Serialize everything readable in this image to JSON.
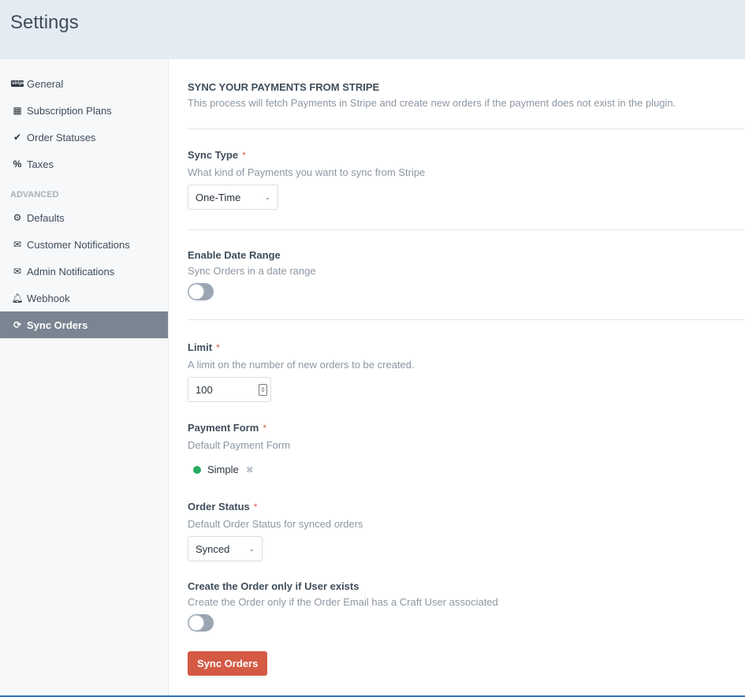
{
  "header": {
    "title": "Settings"
  },
  "sidebar": {
    "items": [
      {
        "label": "General",
        "icon": "stripe-logo-icon"
      },
      {
        "label": "Subscription Plans",
        "icon": "calendar-icon"
      },
      {
        "label": "Order Statuses",
        "icon": "check-circle-icon"
      },
      {
        "label": "Taxes",
        "icon": "percent-icon"
      }
    ],
    "section": "ADVANCED",
    "advanced": [
      {
        "label": "Defaults",
        "icon": "gear-icon"
      },
      {
        "label": "Customer Notifications",
        "icon": "envelope-icon"
      },
      {
        "label": "Admin Notifications",
        "icon": "envelope-icon"
      },
      {
        "label": "Webhook",
        "icon": "bell-icon"
      },
      {
        "label": "Sync Orders",
        "icon": "sync-icon",
        "active": true
      }
    ],
    "stripe_logo": "stripe"
  },
  "main": {
    "title": "SYNC YOUR PAYMENTS FROM STRIPE",
    "description": "This process will fetch Payments in Stripe and create new orders if the payment does not exist in the plugin.",
    "sync_type": {
      "label": "Sync Type",
      "required": "*",
      "hint": "What kind of Payments you want to sync from Stripe",
      "value": "One-Time"
    },
    "date_range": {
      "label": "Enable Date Range",
      "hint": "Sync Orders in a date range",
      "enabled": false
    },
    "limit": {
      "label": "Limit",
      "required": "*",
      "hint": "A limit on the number of new orders to be created.",
      "value": "100"
    },
    "payment_form": {
      "label": "Payment Form",
      "required": "*",
      "hint": "Default Payment Form",
      "value": "Simple",
      "status_color": "#27ab5d"
    },
    "order_status": {
      "label": "Order Status",
      "required": "*",
      "hint": "Default Order Status for synced orders",
      "value": "Synced"
    },
    "user_exists": {
      "label": "Create the Order only if User exists",
      "hint": "Create the Order only if the Order Email has a Craft User associated",
      "enabled": false
    },
    "submit": "Sync Orders"
  },
  "colors": {
    "accent": "#d45a44",
    "active_nav": "#7a8591"
  }
}
